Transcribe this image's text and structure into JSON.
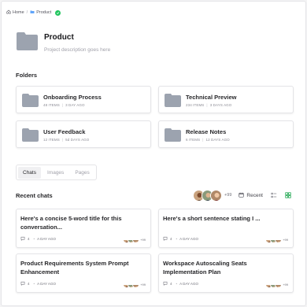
{
  "breadcrumb": {
    "home_label": "Home",
    "separator": "/",
    "product_label": "Product",
    "icons": [
      "home-icon",
      "folder-icon",
      "check-circle-icon"
    ]
  },
  "project": {
    "title": "Product",
    "description": "Project description goes here"
  },
  "folders": {
    "section_title": "Folders",
    "items": [
      {
        "name": "Onboarding Process",
        "items": "48 ITEMS",
        "updated": "3 DAY AGO"
      },
      {
        "name": "Technical Preview",
        "items": "234 ITEMS",
        "updated": "3 DAYS AGO"
      },
      {
        "name": "User Feedback",
        "items": "12 ITEMS",
        "updated": "5d DAYS AGO"
      },
      {
        "name": "Release Notes",
        "items": "6 ITEMS",
        "updated": "12 DAYS AGO"
      }
    ]
  },
  "tabs": [
    {
      "label": "Chats",
      "active": true
    },
    {
      "label": "Images",
      "active": false
    },
    {
      "label": "Pages",
      "active": false
    }
  ],
  "recent": {
    "section_title": "Recent chats",
    "avatar_count": "+99",
    "sort_label": "Recent",
    "icons": [
      "calendar-icon",
      "list-view-icon",
      "grid-view-icon"
    ]
  },
  "chats": [
    {
      "title": "Here's a concise 5-word title for this conversation...",
      "count": "4",
      "time": "A DAY AGO",
      "avatar_count": "+99"
    },
    {
      "title": "Here's a short sentence stating I ...",
      "count": "4",
      "time": "A DAY AGO",
      "avatar_count": "+99"
    },
    {
      "title": "Product Requirements System Prompt Enhancement",
      "count": "4",
      "time": "A DAY AGO",
      "avatar_count": "+99"
    },
    {
      "title": "Workspace Autoscaling Seats Implementation Plan",
      "count": "4",
      "time": "A DAY AGO",
      "avatar_count": "+99"
    }
  ],
  "colors": {
    "accent_green": "#22c55e",
    "folder_gray": "#9ca3af",
    "grid_icon_green": "#16a34a"
  }
}
